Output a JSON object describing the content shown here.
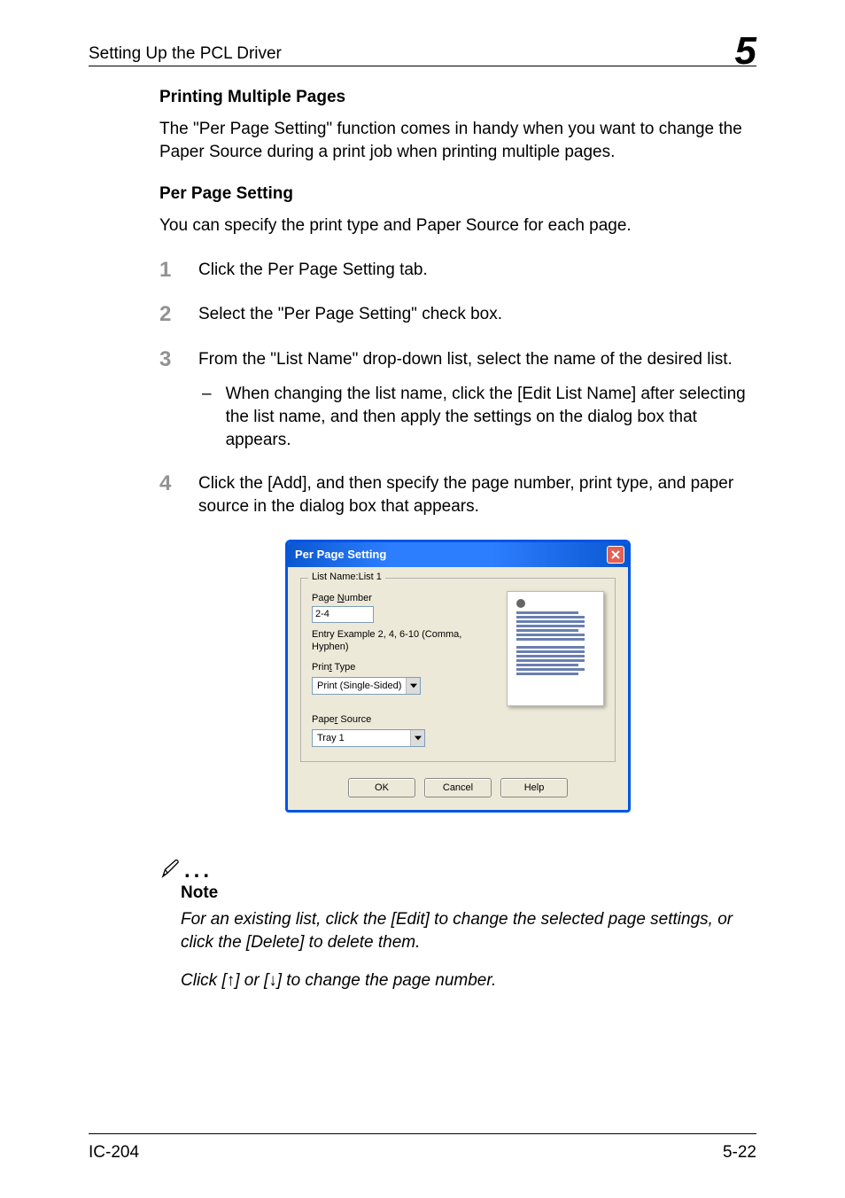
{
  "header": {
    "title": "Setting Up the PCL Driver",
    "chapter": "5"
  },
  "section1": {
    "title": "Printing Multiple Pages",
    "body": "The \"Per Page Setting\" function comes in handy when you want to change the Paper Source during a print job when printing multiple pages."
  },
  "section2": {
    "title": "Per Page Setting",
    "body": "You can specify the print type and Paper Source for each page."
  },
  "steps": [
    {
      "num": "1",
      "text": "Click the Per Page Setting tab."
    },
    {
      "num": "2",
      "text": "Select the \"Per Page Setting\" check box."
    },
    {
      "num": "3",
      "text": "From the \"List Name\" drop-down list, select the name of the desired list.",
      "sub": "When changing the list name, click the [Edit List Name] after selecting the list name, and then apply the settings on the dialog box that appears."
    },
    {
      "num": "4",
      "text": "Click the [Add], and then specify the page number, print type, and paper source in the dialog box that appears."
    }
  ],
  "dialog": {
    "title": "Per Page Setting",
    "legend": "List Name:List 1",
    "pageNumber": {
      "label_pre": "Page ",
      "label_ul": "N",
      "label_post": "umber",
      "value": "2-4",
      "hint": "Entry Example 2, 4, 6-10 (Comma, Hyphen)"
    },
    "printType": {
      "label_pre": "Prin",
      "label_ul": "t",
      "label_post": " Type",
      "value": "Print (Single-Sided)"
    },
    "paperSource": {
      "label_pre": "Pape",
      "label_ul": "r",
      "label_post": " Source",
      "value": "Tray 1"
    },
    "buttons": {
      "ok": "OK",
      "cancel": "Cancel",
      "help": "Help"
    }
  },
  "note": {
    "title": "Note",
    "text1": "For an existing list, click the [Edit] to change the selected page settings, or click the [Delete] to delete them.",
    "text2_pre": "Click [",
    "text2_mid": "] or [",
    "text2_post": "] to change the page number."
  },
  "footer": {
    "left": "IC-204",
    "right": "5-22"
  }
}
